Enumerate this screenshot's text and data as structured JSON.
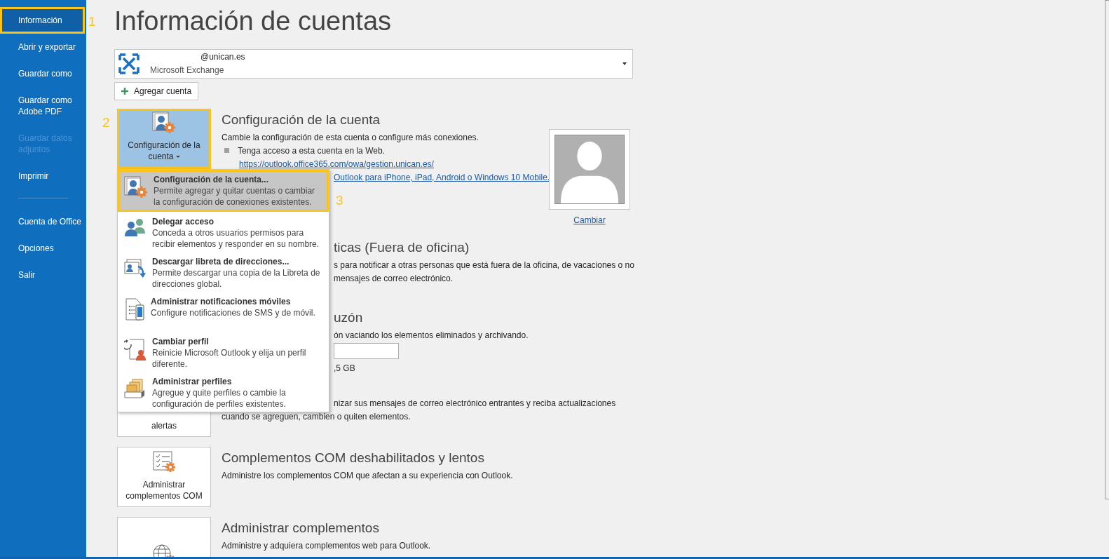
{
  "sidebar": {
    "items": [
      {
        "kind": "item",
        "label": "Información",
        "selected": true,
        "disabled": false,
        "callout": "1"
      },
      {
        "kind": "item",
        "label": "Abrir y exportar",
        "selected": false,
        "disabled": false
      },
      {
        "kind": "item",
        "label": "Guardar como",
        "selected": false,
        "disabled": false
      },
      {
        "kind": "item",
        "label": "Guardar como Adobe PDF",
        "selected": false,
        "disabled": false
      },
      {
        "kind": "item",
        "label": "Guardar datos adjuntos",
        "selected": false,
        "disabled": true
      },
      {
        "kind": "item",
        "label": "Imprimir",
        "selected": false,
        "disabled": false
      },
      {
        "kind": "divider"
      },
      {
        "kind": "item",
        "label": "Cuenta de Office",
        "selected": false,
        "disabled": false
      },
      {
        "kind": "item",
        "label": "Opciones",
        "selected": false,
        "disabled": false
      },
      {
        "kind": "item",
        "label": "Salir",
        "selected": false,
        "disabled": false
      }
    ]
  },
  "title": "Información de cuentas",
  "account": {
    "email": "@unican.es",
    "type": "Microsoft Exchange"
  },
  "add_account_button": "Agregar cuenta",
  "sections": [
    {
      "button": {
        "label": "Configuración de la cuenta",
        "pressed": true,
        "dropdown": true,
        "callout": "2"
      },
      "heading": {
        "text": "Configuración de la cuenta"
      },
      "lines": [
        {
          "kind": "text",
          "text": "Cambie la configuración de esta cuenta o configure más conexiones."
        },
        {
          "kind": "bullet",
          "text": "Tenga acceso a esta cuenta en la Web."
        },
        {
          "kind": "link",
          "text": "https://outlook.office365.com/owa/gestion.unican.es/"
        },
        {
          "kind": "link",
          "text": "Outlook para iPhone, iPad, Android o Windows 10 Mobile.",
          "clipped": true
        }
      ],
      "photo": {
        "link": "Cambiar"
      }
    },
    {
      "heading": {
        "text": "ticas (Fuera de oficina)",
        "clipped": true
      },
      "lines": [
        {
          "kind": "text",
          "text": "s para notificar a otras personas que está fuera de la oficina, de vacaciones o no",
          "clipped": true
        },
        {
          "kind": "text",
          "text": "mensajes de correo electrónico.",
          "clipped": true
        }
      ]
    },
    {
      "heading": {
        "text": "uzón",
        "clipped": true
      },
      "lines": [
        {
          "kind": "text",
          "text": "ón vaciando los elementos eliminados y archivando.",
          "clipped": true
        },
        {
          "kind": "bar",
          "clipped": true
        },
        {
          "kind": "text",
          "text": ",5 GB",
          "clipped": true
        }
      ]
    },
    {
      "button": {
        "label": "alertas",
        "pressed": false
      },
      "lines": [
        {
          "kind": "text",
          "text": "nizar sus mensajes de correo electrónico entrantes y reciba actualizaciones",
          "clipped": true
        },
        {
          "kind": "text",
          "text": "cuando se agreguen, cambien o quiten elementos."
        }
      ]
    },
    {
      "button": {
        "label": "Administrar complementos COM",
        "pressed": false
      },
      "heading": {
        "text": "Complementos COM deshabilitados y lentos"
      },
      "lines": [
        {
          "kind": "text",
          "text": "Administre los complementos COM que afectan a su experiencia con Outlook."
        }
      ]
    },
    {
      "button": {
        "pressed": false
      },
      "heading": {
        "text": "Administrar complementos"
      },
      "lines": [
        {
          "kind": "text",
          "text": "Administre y adquiera complementos web para Outlook."
        }
      ]
    }
  ],
  "menu": {
    "items": [
      {
        "title": "Configuración de la cuenta...",
        "description": "Permite agregar y quitar cuentas o cambiar la configuración de conexiones existentes.",
        "selected": true,
        "callout": "3"
      },
      {
        "title": "Delegar acceso",
        "description": "Conceda a otros usuarios permisos para recibir elementos y responder en su nombre.",
        "selected": false
      },
      {
        "title": "Descargar libreta de direcciones...",
        "description": "Permite descargar una copia de la Libreta de direcciones global.",
        "selected": false
      },
      {
        "title": "Administrar notificaciones móviles",
        "description": "Configure notificaciones de SMS y de móvil.",
        "selected": false
      },
      {
        "title": "Cambiar perfil",
        "description": "Reinicie Microsoft Outlook y elija un perfil diferente.",
        "selected": false
      },
      {
        "title": "Administrar perfiles",
        "description": "Agregue y quite perfiles o cambie la configuración de perfiles existentes.",
        "selected": false
      }
    ]
  }
}
